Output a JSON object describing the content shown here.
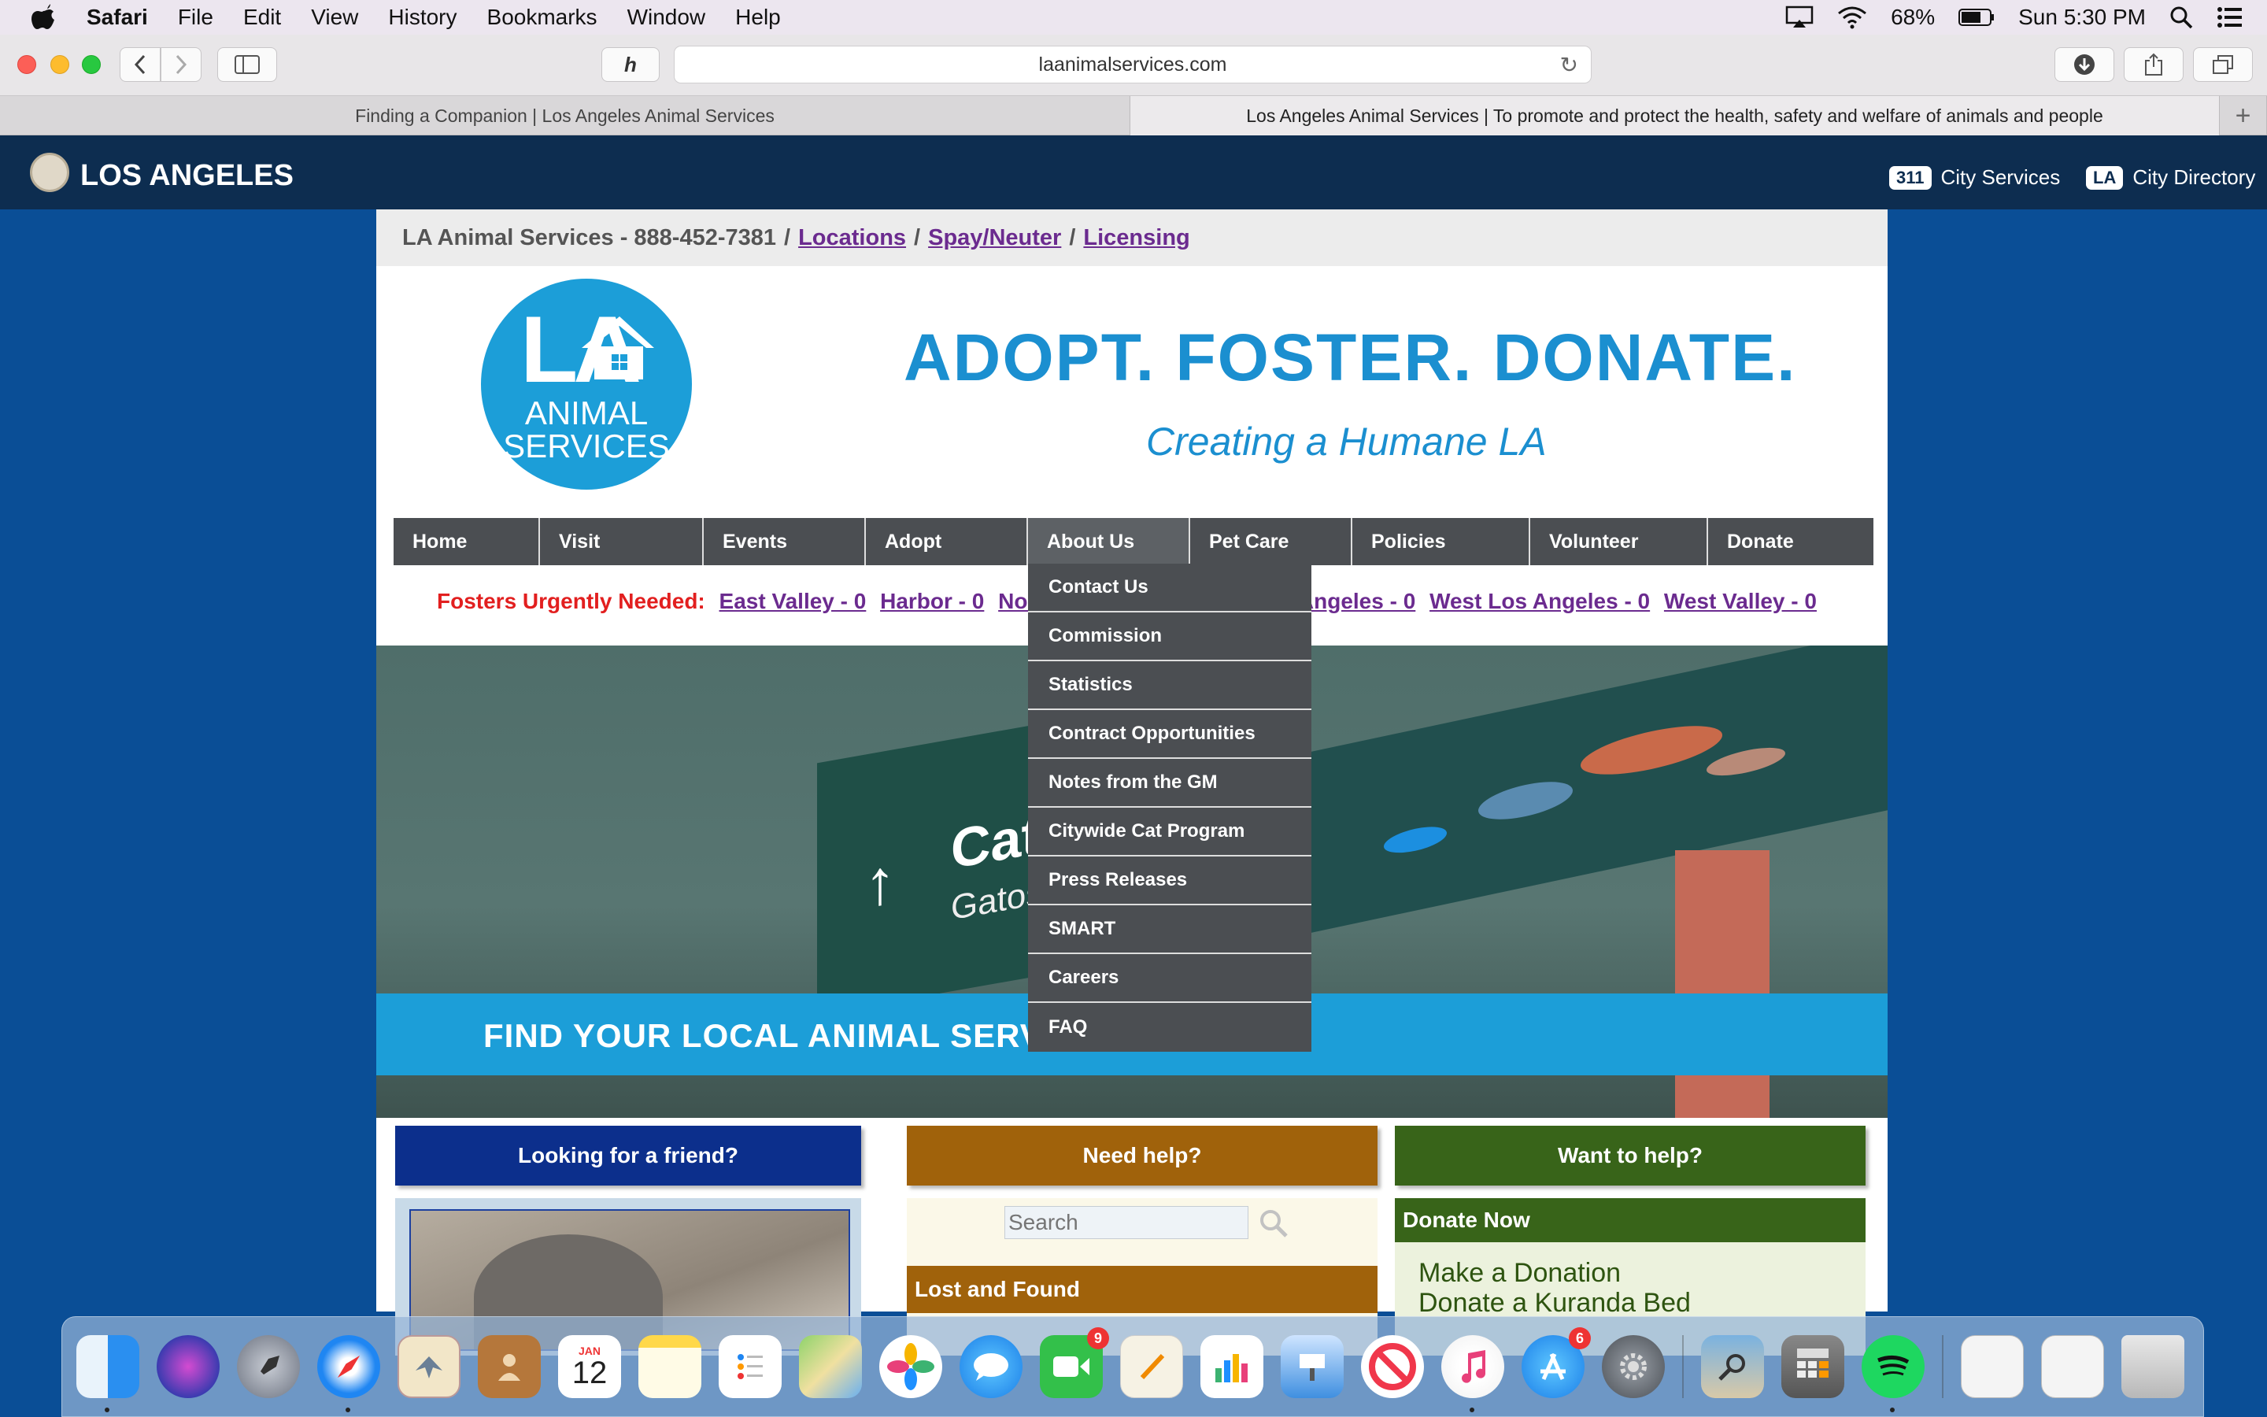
{
  "menubar": {
    "app": "Safari",
    "items": [
      "File",
      "Edit",
      "View",
      "History",
      "Bookmarks",
      "Window",
      "Help"
    ],
    "battery": "68%",
    "clock": "Sun 5:30 PM"
  },
  "browser": {
    "url": "laanimalservices.com",
    "tabs": [
      {
        "title": "Finding a Companion | Los Angeles Animal Services"
      },
      {
        "title": "Los Angeles Animal Services | To promote and protect the health, safety and welfare of animals and people"
      }
    ],
    "new_tab": "+"
  },
  "city_header": {
    "title": "LOS ANGELES",
    "services_badge": "311",
    "services_label": "City Services",
    "directory_badge": "LA",
    "directory_label": "City Directory"
  },
  "infobar": {
    "prefix": "LA Animal Services - 888-452-7381",
    "links": [
      "Locations",
      "Spay/Neuter",
      "Licensing"
    ]
  },
  "logo": {
    "la": "LA",
    "line1": "ANIMAL",
    "line2": "SERVICES"
  },
  "banner": {
    "tagline": "ADOPT. FOSTER. DONATE.",
    "subtagline": "Creating a Humane LA"
  },
  "nav": {
    "items": [
      "Home",
      "Visit",
      "Events",
      "Adopt",
      "About Us",
      "Pet Care",
      "Policies",
      "Volunteer",
      "Donate"
    ],
    "active": "About Us"
  },
  "about_dropdown": [
    "Contact Us",
    "Commission",
    "Statistics",
    "Contract Opportunities",
    "Notes from the GM",
    "Citywide Cat Program",
    "Press Releases",
    "SMART",
    "Careers",
    "FAQ"
  ],
  "fosters": {
    "label": "Fosters Urgently Needed:",
    "links": [
      "East Valley - 0",
      "Harbor - 0",
      "North Central - 0",
      "South Los Angeles - 0",
      "West Los Angeles - 0",
      "West Valley - 0"
    ]
  },
  "hero": {
    "sign_text": "Cats",
    "sign_subtext": "Gatos",
    "band_text": "FIND YOUR LOCAL ANIMAL SERVICES CENTER."
  },
  "cta": {
    "friend": "Looking for a friend?",
    "help": "Need help?",
    "want_help": "Want to help?"
  },
  "search": {
    "placeholder": "Search"
  },
  "lost_found": "Lost and Found",
  "donate_panel": {
    "header": "Donate Now",
    "links": [
      "Make a Donation",
      "Donate a Kuranda Bed"
    ]
  },
  "dock": {
    "calendar_month": "JAN",
    "calendar_day": "12",
    "facetime_badge": "9",
    "appstore_badge": "6"
  }
}
